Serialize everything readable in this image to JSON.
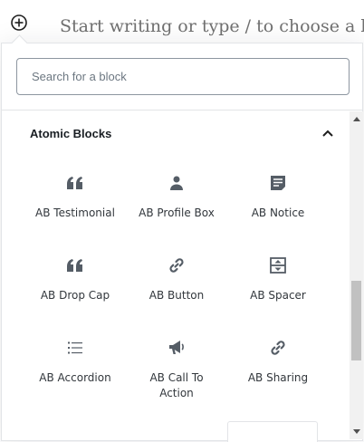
{
  "editor": {
    "placeholder": "Start writing or type / to choose a block"
  },
  "inserter": {
    "search_placeholder": "Search for a block",
    "panel_title": "Atomic Blocks",
    "blocks": [
      {
        "label": "AB Testimonial",
        "icon": "quote-icon"
      },
      {
        "label": "AB Profile Box",
        "icon": "person-icon"
      },
      {
        "label": "AB Notice",
        "icon": "notice-icon"
      },
      {
        "label": "AB Drop Cap",
        "icon": "quote-icon"
      },
      {
        "label": "AB Button",
        "icon": "link-icon"
      },
      {
        "label": "AB Spacer",
        "icon": "spacer-icon"
      },
      {
        "label": "AB Accordion",
        "icon": "list-icon"
      },
      {
        "label": "AB Call To Action",
        "icon": "megaphone-icon"
      },
      {
        "label": "AB Sharing",
        "icon": "link-icon"
      }
    ]
  },
  "colors": {
    "icon": "#555d66",
    "border": "#8d96a0"
  }
}
